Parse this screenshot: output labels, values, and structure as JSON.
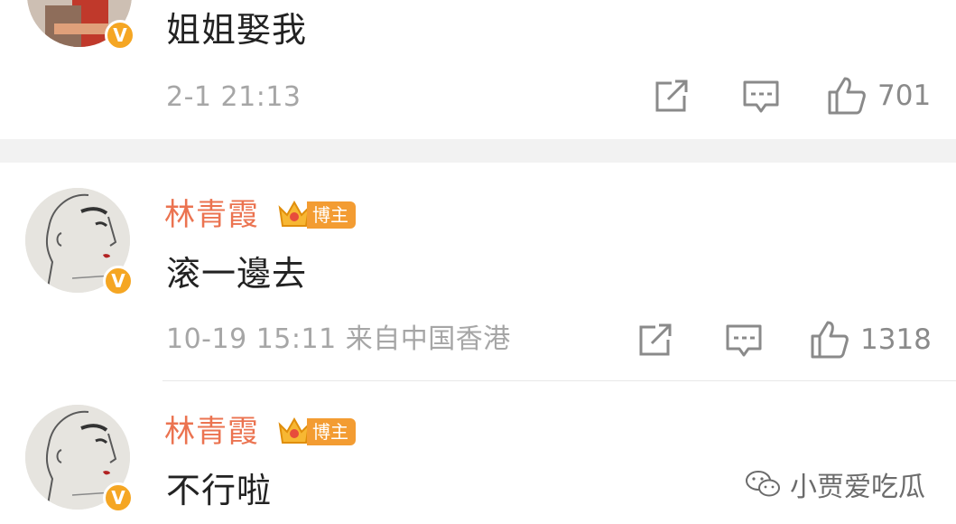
{
  "comments": [
    {
      "text": "姐姐娶我",
      "time": "2-1 21:13",
      "likes": "701"
    },
    {
      "author": "林青霞",
      "badge": "博主",
      "text": "滚一邊去",
      "time": "10-19 15:11 来自中国香港",
      "likes": "1318"
    },
    {
      "author": "林青霞",
      "badge": "博主",
      "text": "不行啦"
    }
  ],
  "watermark": "小贾爱吃瓜",
  "colors": {
    "name": "#eb7350",
    "verify": "#f5a623",
    "badge": "#f39c32",
    "meta": "#a6a6a6"
  },
  "icons": [
    "share-icon",
    "comment-icon",
    "like-icon",
    "verified-icon",
    "crown-icon",
    "wechat-icon"
  ]
}
